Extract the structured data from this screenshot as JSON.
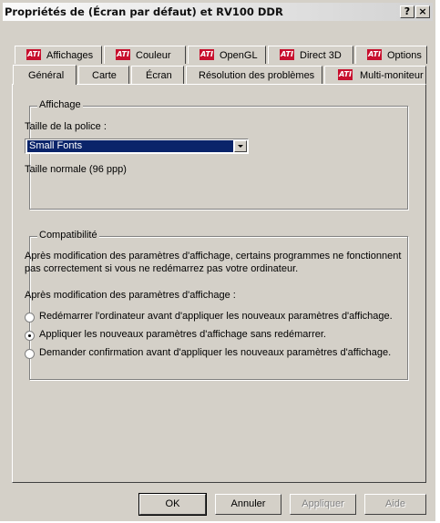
{
  "window": {
    "title": "Propriétés de (Écran par défaut) et RV100 DDR",
    "help_glyph": "?",
    "close_glyph": "×"
  },
  "tabs_row1": [
    {
      "label": "Affichages",
      "icon": "ati-logo-icon"
    },
    {
      "label": "Couleur",
      "icon": "ati-logo-icon"
    },
    {
      "label": "OpenGL",
      "icon": "ati-logo-icon"
    },
    {
      "label": "Direct 3D",
      "icon": "ati-logo-icon"
    },
    {
      "label": "Options",
      "icon": "ati-logo-icon"
    }
  ],
  "tabs_row2": [
    {
      "label": "Général",
      "active": true
    },
    {
      "label": "Carte"
    },
    {
      "label": "Écran"
    },
    {
      "label": "Résolution des problèmes"
    },
    {
      "label": "Multi-moniteur",
      "icon": "ati-logo-icon"
    }
  ],
  "ati_logo_text": "ATI",
  "affichage": {
    "group_title": "Affichage",
    "font_label": "Taille de la police :",
    "font_value": "Small Fonts",
    "size_text": "Taille normale (96 ppp)"
  },
  "compat": {
    "group_title": "Compatibilité",
    "desc_line1": "Après modification des paramètres d'affichage, certains programmes ne fonctionnent",
    "desc_line2": "pas correctement si vous ne redémarrez pas votre ordinateur.",
    "after_label": "Après modification des paramètres d'affichage :",
    "options": [
      {
        "label": "Redémarrer l'ordinateur avant d'appliquer les nouveaux paramètres d'affichage.",
        "selected": false
      },
      {
        "label": "Appliquer les nouveaux paramètres d'affichage sans redémarrer.",
        "selected": true
      },
      {
        "label": "Demander confirmation avant d'appliquer les nouveaux paramètres d'affichage.",
        "selected": false
      }
    ]
  },
  "buttons": {
    "ok": "OK",
    "cancel": "Annuler",
    "apply": "Appliquer",
    "help": "Aide"
  },
  "colors": {
    "title_gradient_start": "#fbfbfb",
    "face": "#d4d0c8",
    "selection": "#0a246a",
    "ati_red": "#c8102e"
  }
}
